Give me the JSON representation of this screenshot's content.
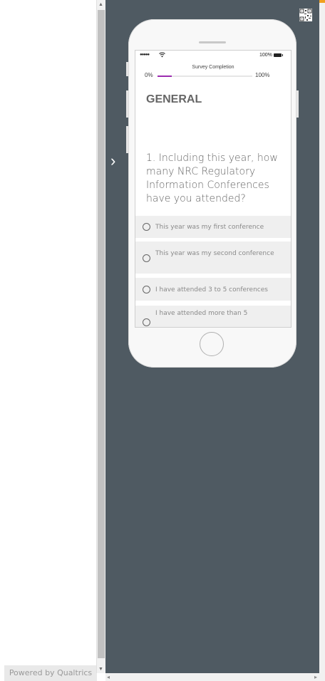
{
  "preview": {
    "powered_by": "Powered by Qualtrics"
  },
  "status_bar": {
    "signal": "●●●●●",
    "wifi": "wifi-icon",
    "battery_text": "100%"
  },
  "progress": {
    "title": "Survey Completion",
    "min_label": "0%",
    "max_label": "100%",
    "value": 0.15,
    "color": "#9c2bb0"
  },
  "survey": {
    "block_title": "GENERAL",
    "question": "1. Including this year, how many NRC Regulatory Information Conferences have you attended?",
    "choices": [
      "This year was my first conference",
      "This year was my second conference",
      "I have attended 3 to 5 conferences",
      "I have attended more than 5"
    ]
  },
  "colors": {
    "background": "#4f5a62",
    "phone": "#f8f8f8",
    "choice_bg": "#efefef"
  }
}
